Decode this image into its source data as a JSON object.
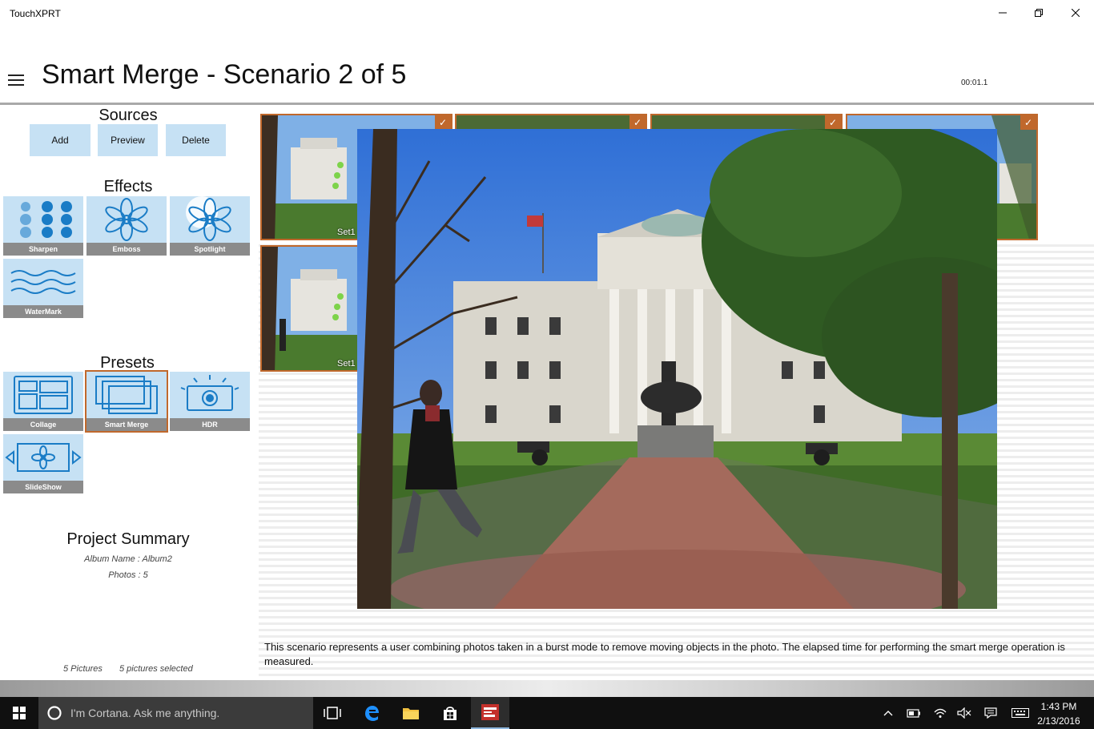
{
  "window": {
    "app_title": "TouchXPRT"
  },
  "header": {
    "page_title": "Smart Merge - Scenario 2 of 5",
    "timer": "00:01.1"
  },
  "sources": {
    "heading": "Sources",
    "buttons": [
      {
        "label": "Add"
      },
      {
        "label": "Preview"
      },
      {
        "label": "Delete"
      }
    ]
  },
  "effects": {
    "heading": "Effects",
    "tiles": [
      {
        "label": "Sharpen",
        "icon": "sharpen-icon"
      },
      {
        "label": "Emboss",
        "icon": "emboss-flower-icon"
      },
      {
        "label": "Spotlight",
        "icon": "spotlight-flower-icon"
      },
      {
        "label": "WaterMark",
        "icon": "watermark-waves-icon"
      }
    ]
  },
  "presets": {
    "heading": "Presets",
    "selected": "Smart Merge",
    "tiles": [
      {
        "label": "Collage",
        "icon": "collage-icon"
      },
      {
        "label": "Smart Merge",
        "icon": "smart-merge-icon"
      },
      {
        "label": "HDR",
        "icon": "hdr-camera-icon"
      },
      {
        "label": "SlideShow",
        "icon": "slideshow-icon"
      }
    ]
  },
  "summary": {
    "title": "Project Summary",
    "album_line": "Album Name : Album2",
    "photos_line": "Photos : 5"
  },
  "footer": {
    "pictures_count": "5 Pictures",
    "selected_count": "5 pictures selected"
  },
  "thumbnails": [
    {
      "label": "Set1",
      "checked": true
    },
    {
      "label": "",
      "checked": true
    },
    {
      "label": "",
      "checked": true
    },
    {
      "label": "",
      "checked": true
    },
    {
      "label": "Set1",
      "checked": true
    }
  ],
  "description": "This scenario represents a user combining photos taken in a burst mode to remove moving objects in the photo. The elapsed time for performing the smart merge operation is measured.",
  "taskbar": {
    "cortana_placeholder": "I'm Cortana. Ask me anything.",
    "clock_time": "1:43 PM",
    "clock_date": "2/13/2016"
  },
  "colors": {
    "accent_selected": "#c0682c",
    "tile_bg": "#c6e1f4",
    "tile_icon": "#1a7cc6",
    "tile_label_bg": "#8b8b8b",
    "taskbar_bg": "#101010"
  }
}
